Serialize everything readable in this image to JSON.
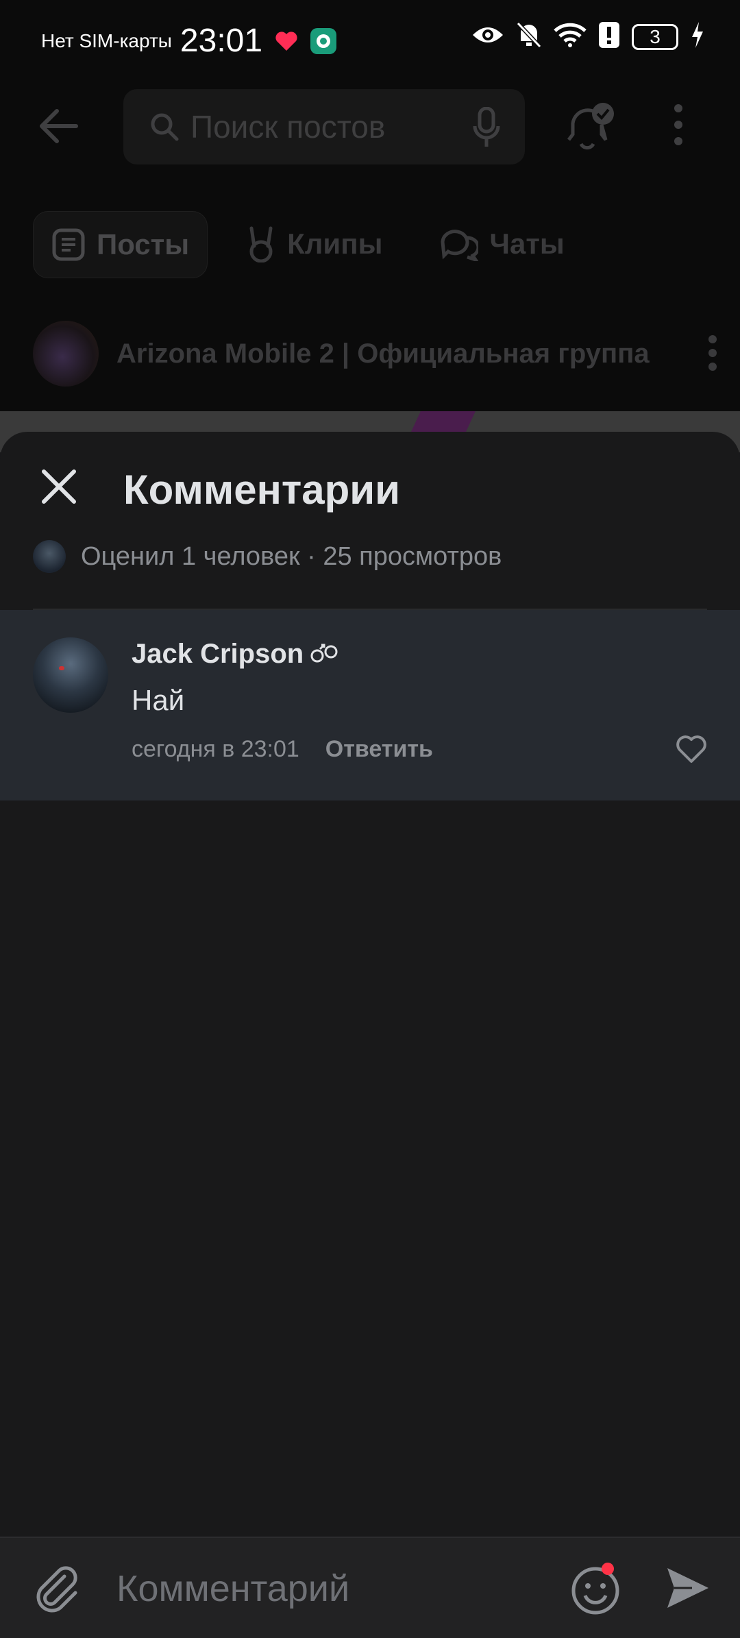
{
  "status_bar": {
    "carrier": "Нет SIM-карты",
    "time": "23:01",
    "battery_level": "3"
  },
  "toolbar": {
    "search_placeholder": "Поиск постов"
  },
  "tabs": [
    {
      "label": "Посты",
      "icon": "posts-icon",
      "active": true
    },
    {
      "label": "Клипы",
      "icon": "clips-icon",
      "active": false
    },
    {
      "label": "Чаты",
      "icon": "chats-icon",
      "active": false
    }
  ],
  "group": {
    "name": "Arizona Mobile 2 | Официальная группа"
  },
  "comments_sheet": {
    "title": "Комментарии",
    "meta": "Оценил 1 человек · 25 просмотров",
    "comments": [
      {
        "author": "Jack Cripson",
        "text": "Най",
        "time": "сегодня в 23:01",
        "reply_label": "Ответить"
      }
    ]
  },
  "input": {
    "placeholder": "Комментарий"
  },
  "colors": {
    "sheet_background": "#19191a",
    "comment_highlight": "#262a30",
    "accent_badge": "#ff3347"
  }
}
